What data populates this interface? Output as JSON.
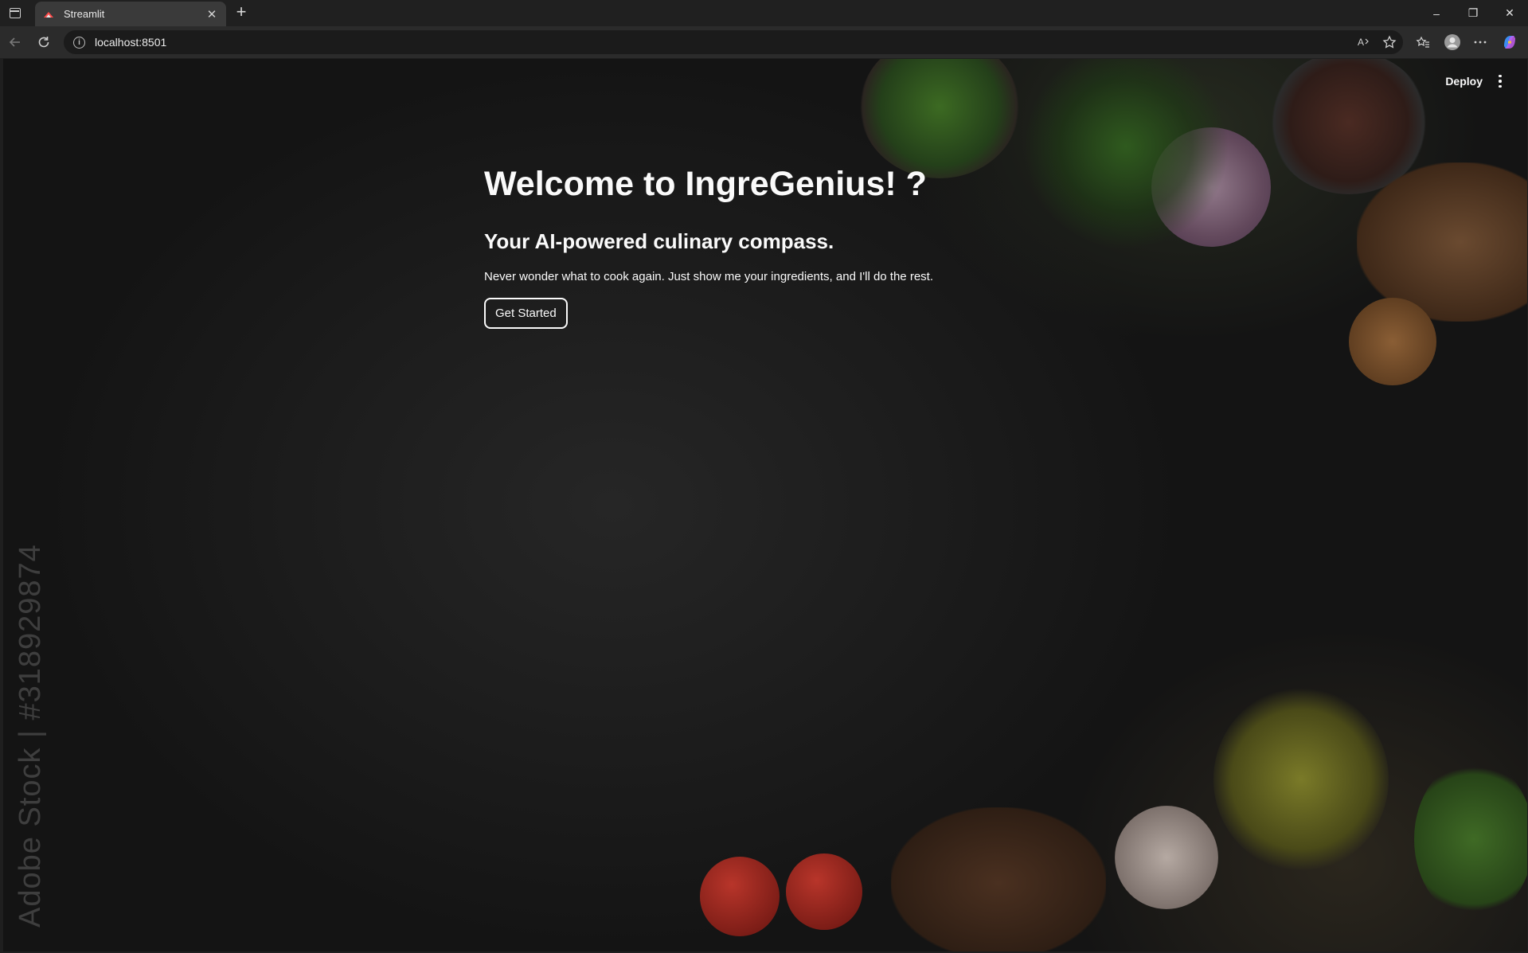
{
  "browser": {
    "tab_title": "Streamlit",
    "tab_close": "✕",
    "new_tab": "+",
    "url": "localhost:8501",
    "window_controls": [
      "–",
      "❐",
      "✕"
    ],
    "icons": [
      "back-icon",
      "refresh-icon",
      "read-aloud-icon",
      "favorite-icon",
      "favorites-bar-icon",
      "profile-icon",
      "more-icon",
      "copilot-icon"
    ]
  },
  "app": {
    "deploy_label": "Deploy",
    "title": "Welcome to IngreGenius! ?",
    "subtitle": "Your AI-powered culinary compass.",
    "description": "Never wonder what to cook again. Just show me your ingredients, and I'll do the rest.",
    "cta_label": "Get Started",
    "watermark": "Adobe Stock | #318929874"
  },
  "colors": {
    "background": "#141414",
    "text": "#fafafa",
    "chrome": "#202020"
  }
}
